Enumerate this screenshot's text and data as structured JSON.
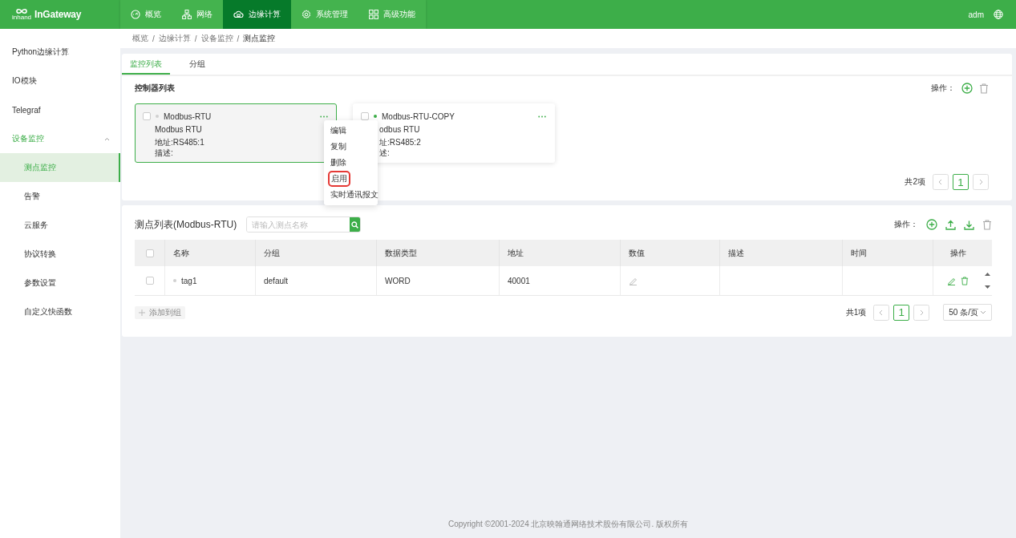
{
  "header": {
    "logo_sub": "inhand",
    "logo_text": "InGateway",
    "nav": [
      {
        "label": "概览",
        "selected": false
      },
      {
        "label": "网络",
        "selected": false
      },
      {
        "label": "边缘计算",
        "selected": true
      },
      {
        "label": "系统管理",
        "selected": false
      },
      {
        "label": "高级功能",
        "selected": false
      }
    ],
    "user": "adm"
  },
  "sidebar": {
    "items": [
      {
        "label": "Python边缘计算",
        "selected": false
      },
      {
        "label": "IO模块",
        "selected": false
      },
      {
        "label": "Telegraf",
        "selected": false
      },
      {
        "label": "设备监控",
        "expanded": true,
        "children": [
          {
            "label": "测点监控",
            "selected": true
          },
          {
            "label": "告警",
            "selected": false
          },
          {
            "label": "云服务",
            "selected": false
          },
          {
            "label": "协议转换",
            "selected": false
          },
          {
            "label": "参数设置",
            "selected": false
          },
          {
            "label": "自定义快函数",
            "selected": false
          }
        ]
      }
    ]
  },
  "breadcrumb": {
    "separator": "/",
    "items": [
      "概览",
      "边缘计算",
      "设备监控",
      "测点监控"
    ]
  },
  "controller_panel": {
    "tabs": [
      {
        "label": "监控列表",
        "selected": true
      },
      {
        "label": "分组",
        "selected": false
      }
    ],
    "title": "控制器列表",
    "ops_label": "操作：",
    "controllers": [
      {
        "name": "Modbus-RTU",
        "protocol": "Modbus RTU",
        "address": "地址:RS485:1",
        "description": "描述:",
        "enabled": false,
        "checked": false,
        "selected": true
      },
      {
        "name": "Modbus-RTU-COPY",
        "protocol": "odbus RTU",
        "address": "址:RS485:2",
        "description": "述:",
        "enabled": true,
        "checked": false,
        "selected": false
      }
    ],
    "context_menu": [
      {
        "label": "编辑",
        "highlighted": false
      },
      {
        "label": "复制",
        "highlighted": false
      },
      {
        "label": "删除",
        "highlighted": false
      },
      {
        "label": "启用",
        "highlighted": true
      },
      {
        "label": "实时通讯报文",
        "highlighted": false
      }
    ],
    "pagination": {
      "total": "共2项",
      "pages": [
        {
          "label": "1",
          "selected": true
        }
      ]
    }
  },
  "points_panel": {
    "title": "测点列表(Modbus-RTU)",
    "search": {
      "placeholder": "请输入测点名称"
    },
    "ops_label": "操作：",
    "table": {
      "all_checked": false,
      "columns": [
        "名称",
        "分组",
        "数据类型",
        "地址",
        "数值",
        "描述",
        "时间",
        "操作"
      ],
      "rows": [
        {
          "checked": false,
          "enabled": false,
          "cells": [
            "tag1",
            "default",
            "WORD",
            "40001"
          ]
        }
      ]
    },
    "add_to_group": {
      "label": "添加到组",
      "disabled": true
    },
    "pagination": {
      "total": "共1项",
      "pages": [
        {
          "label": "1",
          "selected": true
        }
      ],
      "page_size": "50 条/页"
    }
  },
  "footer": "Copyright ©2001-2024 北京映翰通网络技术股份有限公司. 版权所有"
}
